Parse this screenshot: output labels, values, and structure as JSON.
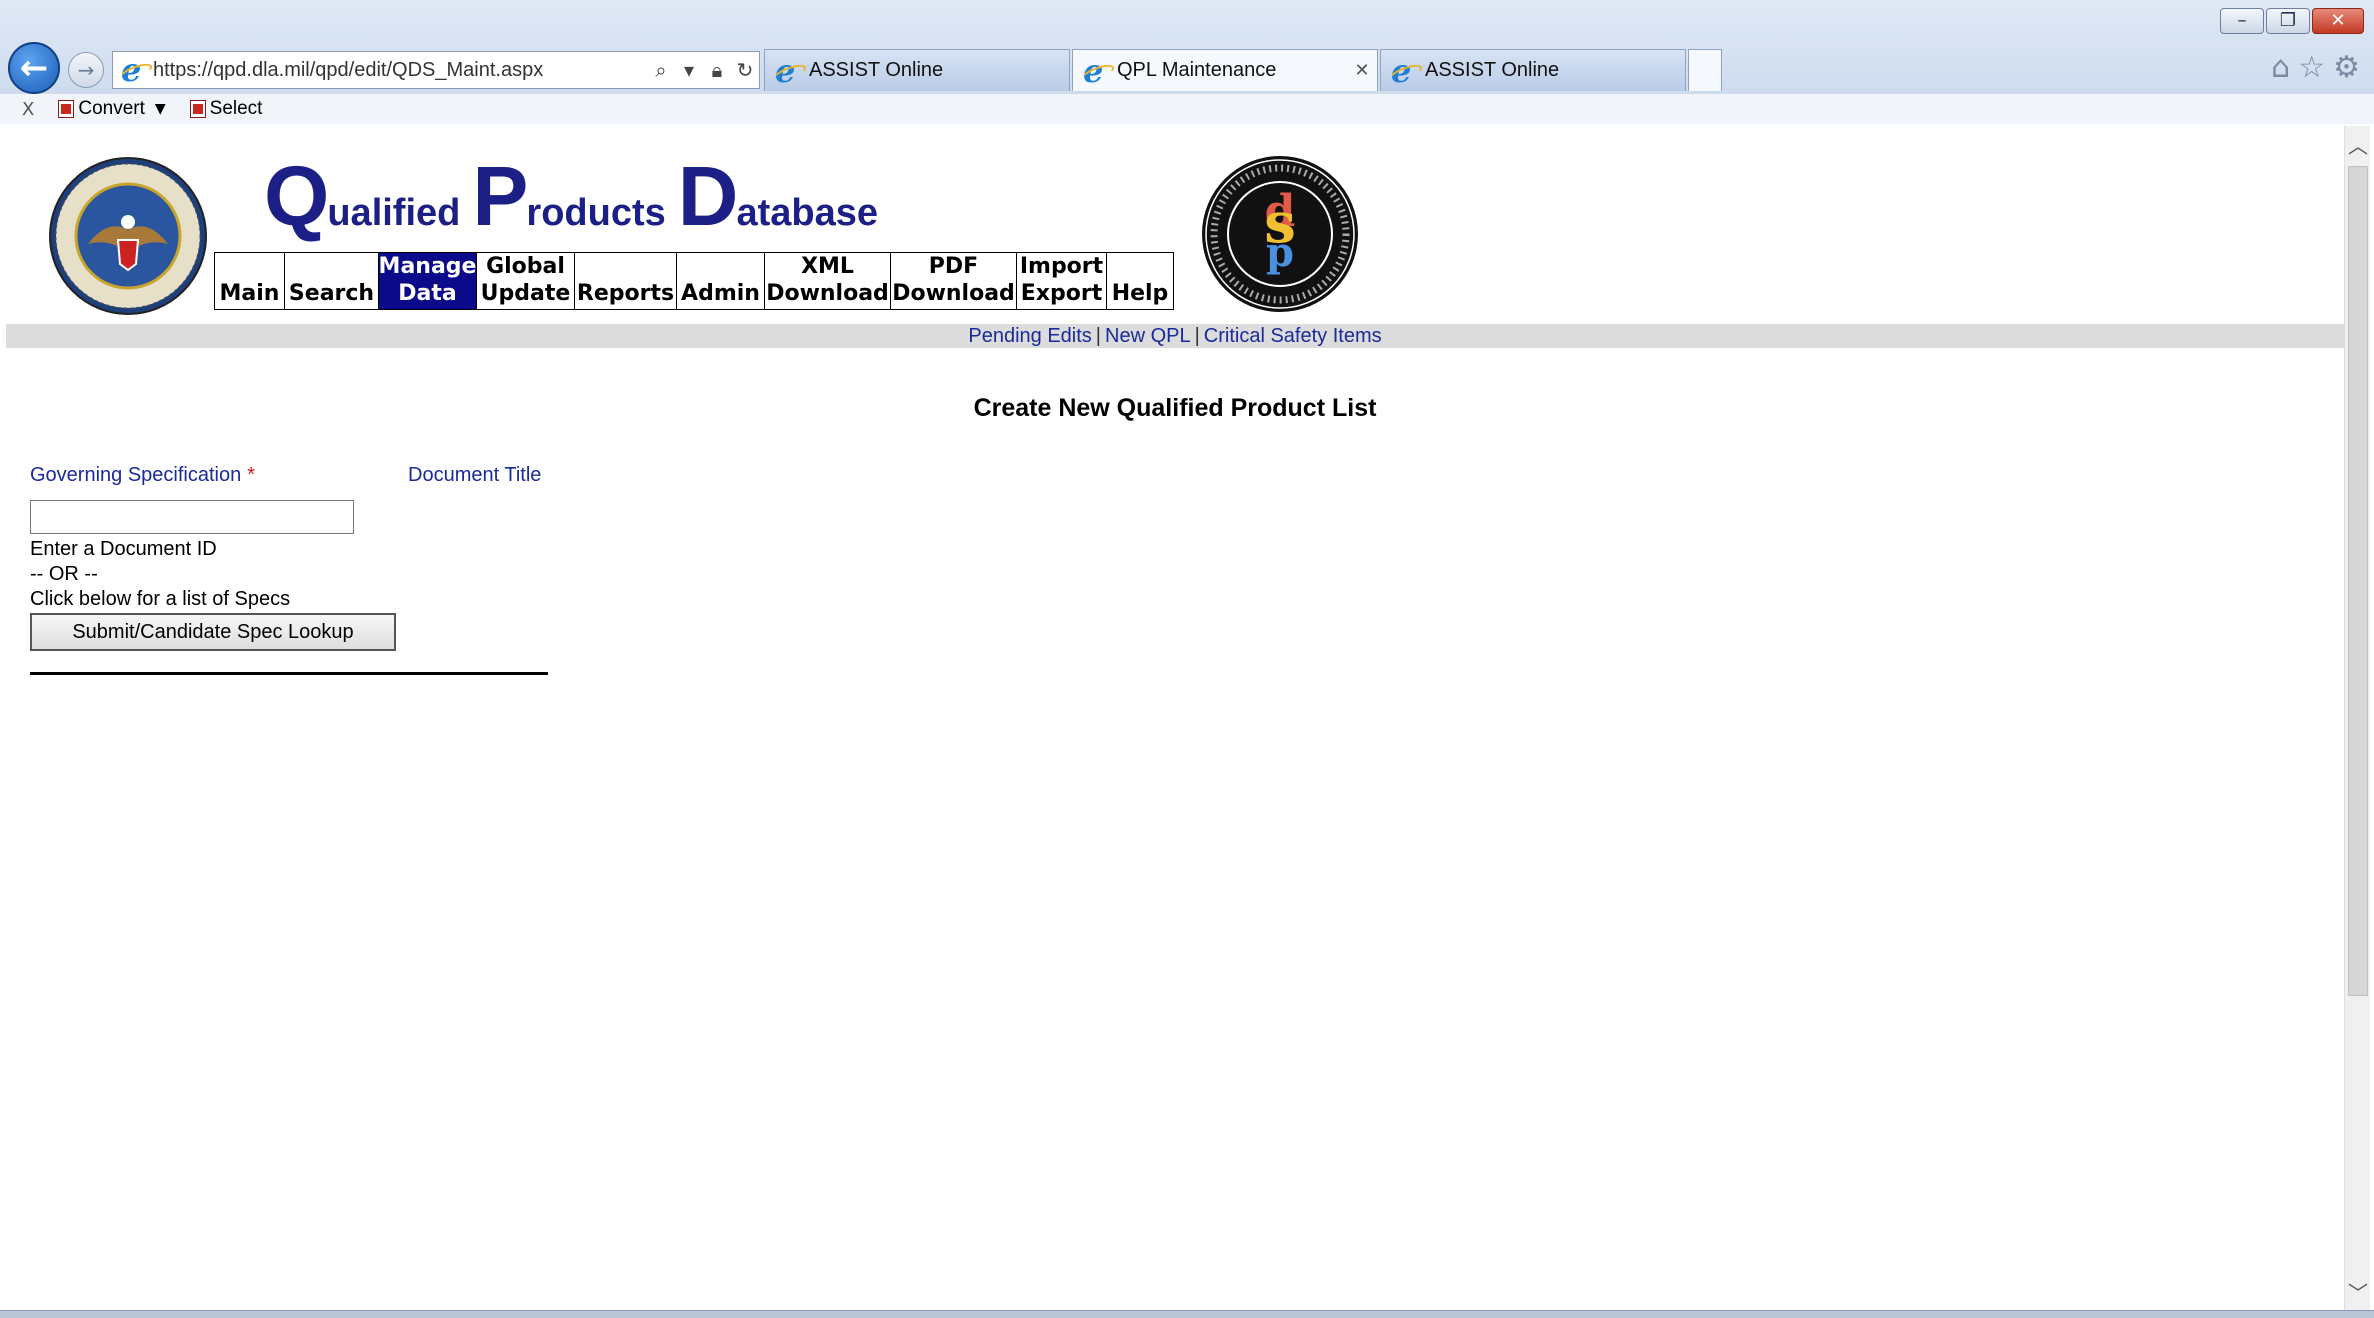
{
  "browser": {
    "address_url": "https://qpd.dla.mil/qpd/edit/QDS_Maint.aspx",
    "tabs": [
      {
        "label": "ASSIST Online",
        "active": false
      },
      {
        "label": "QPL Maintenance",
        "active": true
      },
      {
        "label": "ASSIST Online",
        "active": false
      }
    ],
    "command_bar": {
      "close": "X",
      "convert": "Convert",
      "select": "Select"
    }
  },
  "header": {
    "logo": {
      "q": "Q",
      "q_rest": "ualified",
      "p": "P",
      "p_rest": "roducts",
      "d": "D",
      "d_rest": "atabase"
    },
    "nav": [
      {
        "line1": "",
        "line2": "Main",
        "active": false
      },
      {
        "line1": "",
        "line2": "Search",
        "active": false
      },
      {
        "line1": "Manage",
        "line2": "Data",
        "active": true
      },
      {
        "line1": "Global",
        "line2": "Update",
        "active": false
      },
      {
        "line1": "",
        "line2": "Reports",
        "active": false
      },
      {
        "line1": "",
        "line2": "Admin",
        "active": false
      },
      {
        "line1": "XML",
        "line2": "Download",
        "active": false
      },
      {
        "line1": "PDF",
        "line2": "Download",
        "active": false
      },
      {
        "line1": "Import",
        "line2": "Export",
        "active": false
      },
      {
        "line1": "",
        "line2": "Help",
        "active": false
      }
    ],
    "dsp_letters": {
      "d": "d",
      "s": "s",
      "p": "p"
    }
  },
  "sub_nav": {
    "pending_edits": "Pending Edits",
    "new_qpl": "New QPL",
    "critical_safety": "Critical Safety Items",
    "separator": "|"
  },
  "form": {
    "title": "Create New Qualified Product List",
    "gov_spec_label": "Governing Specification",
    "required_mark": "*",
    "doc_title_label": "Document Title",
    "doc_id_value": "",
    "help_1": "Enter a Document ID",
    "help_2": "-- OR --",
    "help_3": "Click below for a list of Specs",
    "lookup_button": "Submit/Candidate Spec Lookup"
  },
  "colors": {
    "nav_active_bg": "#0a0a8a",
    "link": "#1b2a9a",
    "required": "#d01818",
    "logo": "#1b1f86"
  }
}
